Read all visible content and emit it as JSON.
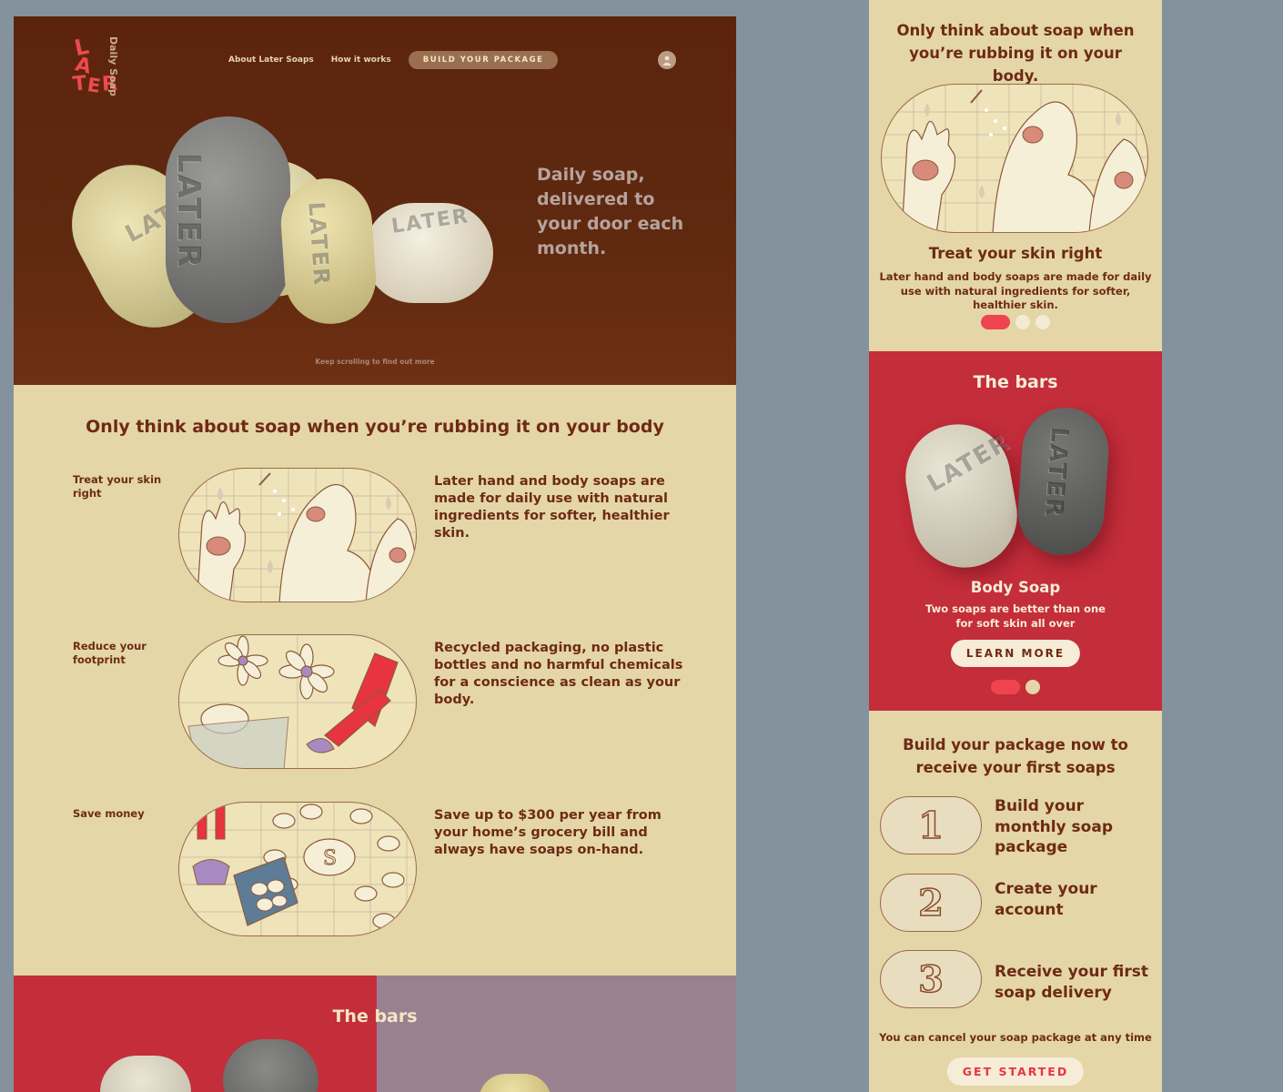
{
  "desktop": {
    "logo": {
      "wordmark": [
        "L",
        "A",
        "T",
        "E",
        "R"
      ],
      "tagline": "Daily Soap"
    },
    "nav": {
      "about": "About Later Soaps",
      "how": "How it works",
      "cta": "BUILD YOUR PACKAGE"
    },
    "hero": {
      "title": "Daily soap, delivered to your door each month.",
      "scroll_hint": "Keep scrolling to find out more",
      "bar_stamp": "LATER"
    },
    "benefits": {
      "title": "Only think about soap when you’re rubbing it on your body",
      "items": [
        {
          "label": "Treat your skin right",
          "text": "Later hand and body soaps are made for daily use with natural ingredients for softer, healthier skin."
        },
        {
          "label": "Reduce your footprint",
          "text": "Recycled packaging, no plastic bottles and no harmful chemicals for a conscience as clean as your body."
        },
        {
          "label": "Save money",
          "text": "Save up to $300 per year from your home’s grocery bill and always have soaps on-hand."
        }
      ]
    },
    "bars": {
      "title": "The bars"
    }
  },
  "mobile": {
    "benefits": {
      "title": "Only think about soap when you’re rubbing it on your body.",
      "slide_title": "Treat your skin right",
      "slide_text": "Later hand and body soaps are made for daily use with natural ingredients for softer, healthier skin.",
      "dots_total": 3,
      "dots_active": 1
    },
    "bars": {
      "title": "The bars",
      "product_name": "Body Soap",
      "product_desc": "Two soaps are better than one for soft skin all over",
      "cta": "LEARN MORE",
      "dots_total": 2,
      "dots_active": 1
    },
    "steps": {
      "title": "Build your package now to receive your first soaps",
      "items": [
        {
          "num": "1",
          "text": "Build your monthly soap package"
        },
        {
          "num": "2",
          "text": "Create your account"
        },
        {
          "num": "3",
          "text": "Receive your first soap delivery"
        }
      ],
      "cancel_note": "You can cancel your soap package at any time",
      "cta": "GET STARTED"
    }
  },
  "colors": {
    "accent_red": "#ee4450",
    "brown_text": "#6e2a14",
    "cream": "#e4d6a7",
    "hero_brown": "#5f2910",
    "bars_red": "#c42d3a",
    "bars_mauve": "#9a8190",
    "page_bg": "#84929e"
  },
  "icons": [
    "user-icon"
  ]
}
